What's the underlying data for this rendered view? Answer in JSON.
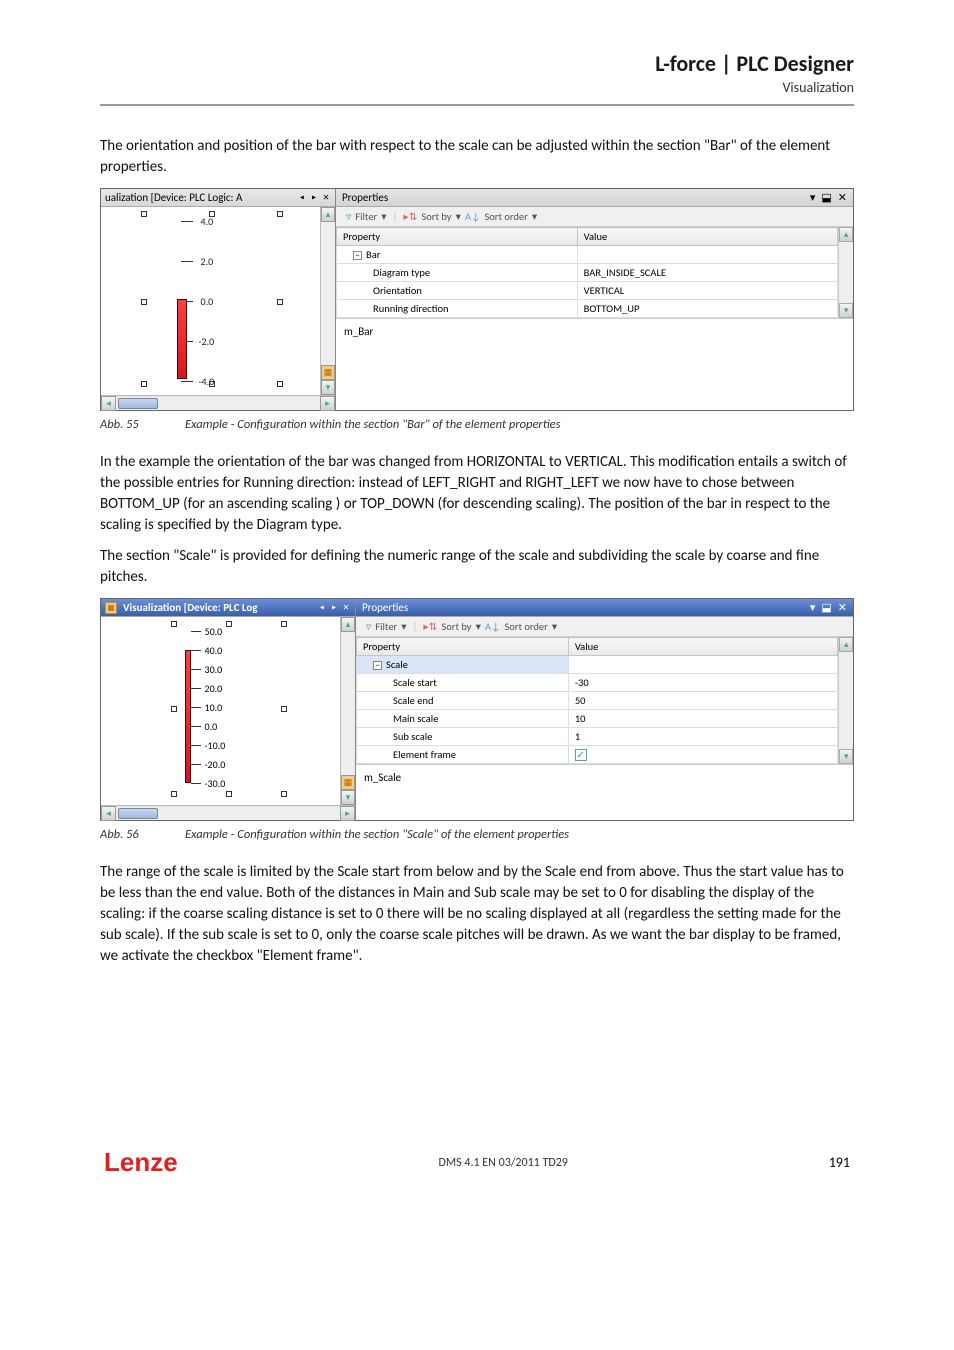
{
  "header": {
    "title": "L-force | PLC Designer",
    "subtitle": "Visualization"
  },
  "para1": "The orientation and position of the bar with respect to the scale can be adjusted within the section \"Bar\" of the element properties.",
  "fig1": {
    "vis_title": "ualization [Device: PLC Logic: A",
    "ticks": [
      "4.0",
      "2.0",
      "0.0",
      "-2.0",
      "-4.0"
    ],
    "props_title": "Properties",
    "toolbar": {
      "filter": "Filter",
      "sortby": "Sort by",
      "sortorder": "Sort order"
    },
    "cols": {
      "prop": "Property",
      "val": "Value"
    },
    "rows": [
      {
        "k": "Bar",
        "grp": true
      },
      {
        "k": "Diagram type",
        "v": "BAR_INSIDE_SCALE"
      },
      {
        "k": "Orientation",
        "v": "VERTICAL"
      },
      {
        "k": "Running direction",
        "v": "BOTTOM_UP"
      }
    ],
    "footer": "m_Bar"
  },
  "caption1": {
    "num": "Abb. 55",
    "text": "Example - Configuration within the section \"Bar\" of the element properties"
  },
  "para2": "In the example the orientation of the bar was changed from HORIZONTAL to VERTICAL. This modification entails a switch of the possible entries for Running direction: instead of LEFT_RIGHT and RIGHT_LEFT we now have to chose between BOTTOM_UP (for an ascending scaling ) or TOP_DOWN (for descending scaling).  The position of the bar in respect to the scaling is specified by the Diagram type.",
  "para3": "The section \"Scale\" is provided for defining the numeric range of the scale and subdividing the scale by coarse and fine pitches.",
  "fig2": {
    "vis_title": "Visualization [Device: PLC Log",
    "ticks": [
      "50.0",
      "40.0",
      "30.0",
      "20.0",
      "10.0",
      "0.0",
      "-10.0",
      "-20.0",
      "-30.0"
    ],
    "props_title": "Properties",
    "cols": {
      "prop": "Property",
      "val": "Value"
    },
    "rows": [
      {
        "k": "Scale",
        "grp": true,
        "sel": true
      },
      {
        "k": "Scale start",
        "v": "-30"
      },
      {
        "k": "Scale end",
        "v": "50"
      },
      {
        "k": "Main scale",
        "v": "10"
      },
      {
        "k": "Sub scale",
        "v": "1"
      },
      {
        "k": "Element frame",
        "v": "[check]"
      }
    ],
    "footer": "m_Scale"
  },
  "caption2": {
    "num": "Abb. 56",
    "text": "Example - Configuration within the section \"Scale\" of the element properties"
  },
  "para4": "The range of the scale is limited by the Scale start from below and by the Scale end from above. Thus the start value has to be less than the end value. Both of the distances in Main and Sub scale may be set to 0 for disabling the display of the scaling: if the coarse scaling distance is set to 0 there will be no scaling displayed at all (regardless the setting made for the sub scale). If the sub scale is set to 0, only the coarse scale pitches will be drawn.  As we want the bar display to be framed, we activate the checkbox \"Element frame\".",
  "footer": {
    "logo": "Lenze",
    "center": "DMS 4.1 EN 03/2011 TD29",
    "page": "191"
  }
}
